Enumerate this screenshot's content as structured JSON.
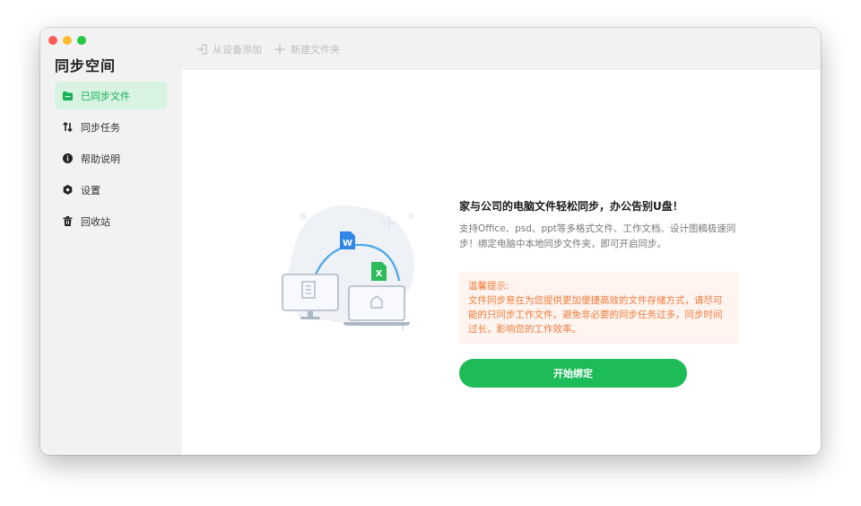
{
  "app": {
    "title": "同步空间"
  },
  "sidebar": {
    "items": [
      {
        "label": "已同步文件",
        "icon": "folder-icon",
        "active": true
      },
      {
        "label": "同步任务",
        "icon": "sync-arrows-icon",
        "active": false
      },
      {
        "label": "帮助说明",
        "icon": "info-icon",
        "active": false
      },
      {
        "label": "设置",
        "icon": "gear-icon",
        "active": false
      },
      {
        "label": "回收站",
        "icon": "trash-icon",
        "active": false
      }
    ]
  },
  "toolbar": {
    "add_from_device": "从设备添加",
    "new_folder": "新建文件夹"
  },
  "main": {
    "headline": "家与公司的电脑文件轻松同步，办公告别U盘！",
    "description": "支持Office、psd、ppt等多格式文件、工作文档、设计图稿极速同步！绑定电脑中本地同步文件夹，即可开启同步。",
    "tip_title": "温馨提示:",
    "tip_body": "文件同步意在为您提供更加便捷高效的文件存储方式，请尽可能的只同步工作文件。避免非必要的同步任务过多，同步时间过长，影响您的工作效率。",
    "start_button": "开始绑定",
    "illustration_badge_word": "W",
    "illustration_badge_excel": "X"
  },
  "colors": {
    "accent": "#1ebb59",
    "active_bg": "#d8f3e2",
    "tip_text": "#ee7a3a",
    "tip_bg": "#fff4ef"
  }
}
